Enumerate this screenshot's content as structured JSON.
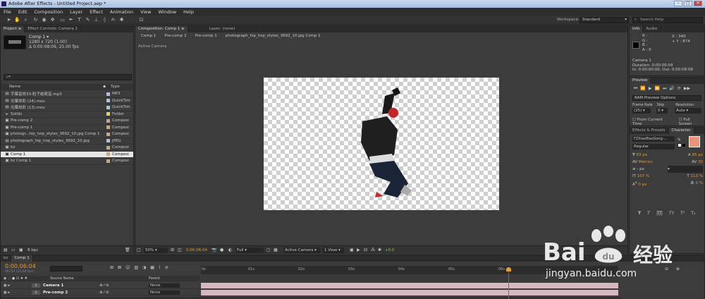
{
  "app": {
    "title": "Adobe After Effects - Untitled Project.aep *"
  },
  "menu": [
    "File",
    "Edit",
    "Composition",
    "Layer",
    "Effect",
    "Animation",
    "View",
    "Window",
    "Help"
  ],
  "toolbar": {
    "workspace_label": "Workspace:",
    "workspace_value": "Standard",
    "search_placeholder": "Search Help"
  },
  "project": {
    "tab_project": "Project ≡",
    "tab_effect": "Effect Controls: Camera 1",
    "comp_name": "Comp 1 ▾",
    "comp_info1": "1280 x 720 (1.00)",
    "comp_info2": "Δ 0:00:08:09, 25.00 fps",
    "search_placeholder": "ρ▾",
    "col_name": "Name",
    "col_type": "Type",
    "items": [
      {
        "name": "字幕音效33-粒子结尾音.mp3",
        "type": "MP3",
        "color": "#b9b9e5"
      },
      {
        "name": "光暈炫彩 (24).mov",
        "type": "QuickTim",
        "color": "#a9c5d8"
      },
      {
        "name": "光暈炫彩 (13).mov",
        "type": "QuickTim",
        "color": "#a9c5d8"
      },
      {
        "name": "Solids",
        "type": "Folder",
        "color": "#e5d24f"
      },
      {
        "name": "Pre-comp 2",
        "type": "Composi",
        "color": "#c3a88a"
      },
      {
        "name": "Pre-comp 1",
        "type": "Composi",
        "color": "#c3a88a"
      },
      {
        "name": "photogr...hip_hop_styles_3692_10.jpg Comp 1",
        "type": "Composi",
        "color": "#c3a88a"
      },
      {
        "name": "photograph_hip_hop_styles_3692_10.jpg",
        "type": "JPEG",
        "color": "#b9b9e5"
      },
      {
        "name": "bz",
        "type": "Composi",
        "color": "#c3a88a"
      },
      {
        "name": "Comp 1",
        "type": "Composi",
        "color": "#c3a88a",
        "selected": true
      },
      {
        "name": "bz Comp 1",
        "type": "Composi",
        "color": "#c3a88a"
      }
    ],
    "bpc": "8 bpc"
  },
  "composition": {
    "tab_comp": "Composition: Comp 1 ≡",
    "tab_layer": "Layer: (none)",
    "breadcrumbs": [
      "Comp 1",
      "Pre-comp 2",
      "Pre-comp 1",
      "photograph_hip_hop_styles_3692_10.jpg Comp 1"
    ],
    "view_label": "Active Camera",
    "zoom": "50%",
    "timecode": "0:00:06:04",
    "resolution": "Full",
    "camera": "Active Camera",
    "views": "1 View",
    "exposure": "+0.0"
  },
  "info": {
    "tab_info": "Info",
    "tab_audio": "Audio",
    "r": "R :",
    "g": "G :",
    "b": "B :",
    "a": "A : 0",
    "x": "X : 340",
    "y": "+ Y : 874",
    "layer": "Camera 1",
    "duration": "Duration: 0:00:00:09",
    "inout": "In: 0:00:00:00, Out: 0:00:08:08"
  },
  "preview": {
    "tab": "Preview",
    "ram": "RAM Preview Options",
    "frame_rate_label": "Frame Rate",
    "skip_label": "Skip",
    "resolution_label": "Resolution",
    "frame_rate": "(25)",
    "skip": "0",
    "resolution": "Auto",
    "from_current": "From Current Time",
    "full_screen": "Full Screen"
  },
  "character": {
    "tab_effects": "Effects & Presets",
    "tab_char": "Character",
    "font": "FZXiaoBiaoSong-...",
    "style": "Regular",
    "size": "83 px",
    "leading": "85 px",
    "kerning": "Metrics",
    "tracking": "30",
    "stroke": "- px",
    "vscale": "107 %",
    "hscale": "113 %",
    "baseline": "0 px",
    "tsume": "0 %",
    "fill_color": "#e8957a"
  },
  "timeline": {
    "tab_bz": "bz",
    "tab_comp": "Comp 1",
    "timecode": "0:00:06:04",
    "frames": "00154 (25.00 fps)",
    "col_source": "Source Name",
    "col_parent": "Parent",
    "ruler": [
      "0s",
      "01s",
      "02s",
      "03s",
      "04s",
      "05s",
      "06s"
    ],
    "layers": [
      {
        "num": "1",
        "name": "Camera 1",
        "parent": "None"
      },
      {
        "num": "2",
        "name": "Pre-comp 2",
        "parent": "None"
      }
    ]
  },
  "watermark": {
    "brand": "Bai",
    "brand2": "du",
    "cn": "经验",
    "url": "jingyan.baidu.com"
  }
}
